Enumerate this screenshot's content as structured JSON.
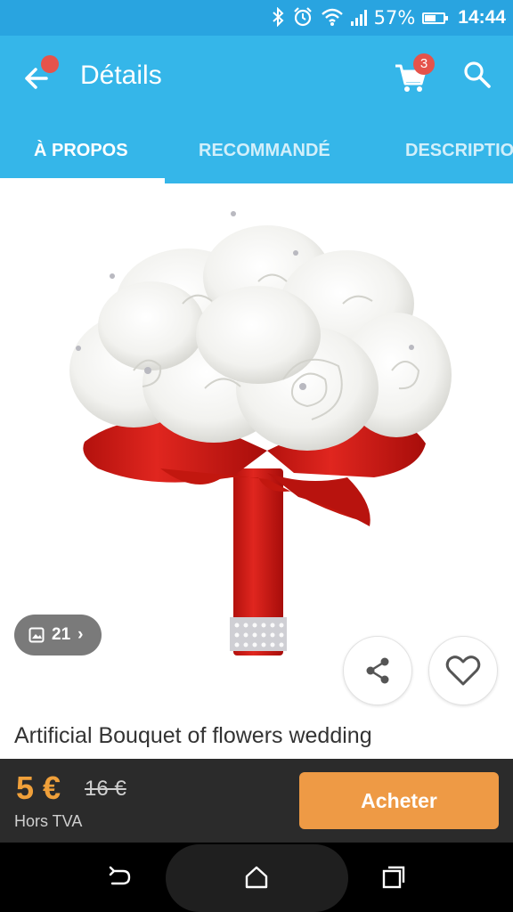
{
  "status_bar": {
    "battery": "57%",
    "time": "14:44",
    "icons": [
      "bluetooth-icon",
      "alarm-icon",
      "wifi-icon",
      "signal-icon",
      "battery-icon"
    ]
  },
  "app_bar": {
    "title": "Détails",
    "cart_count": "3",
    "icons": [
      "back-arrow-icon",
      "cart-icon",
      "search-icon"
    ]
  },
  "tabs": [
    {
      "label": "À PROPOS",
      "active": true
    },
    {
      "label": "RECOMMANDÉ",
      "active": false
    },
    {
      "label": "DESCRIPTIO",
      "active": false
    }
  ],
  "product": {
    "image_count": "21",
    "title": "Artificial Bouquet of flowers wedding",
    "colors": {
      "ribbon": "#d5211c",
      "petals": "#f4f4f2"
    }
  },
  "price_bar": {
    "price": "5 €",
    "old_price": "16 €",
    "tax_note": "Hors TVA",
    "buy_label": "Acheter"
  },
  "colors": {
    "status_bar": "#29a4e0",
    "app_bar": "#35b6e9",
    "badge": "#e5534b",
    "price_accent": "#f0a03a",
    "buy_button": "#ee9a45",
    "price_bar": "#2b2b2b"
  }
}
